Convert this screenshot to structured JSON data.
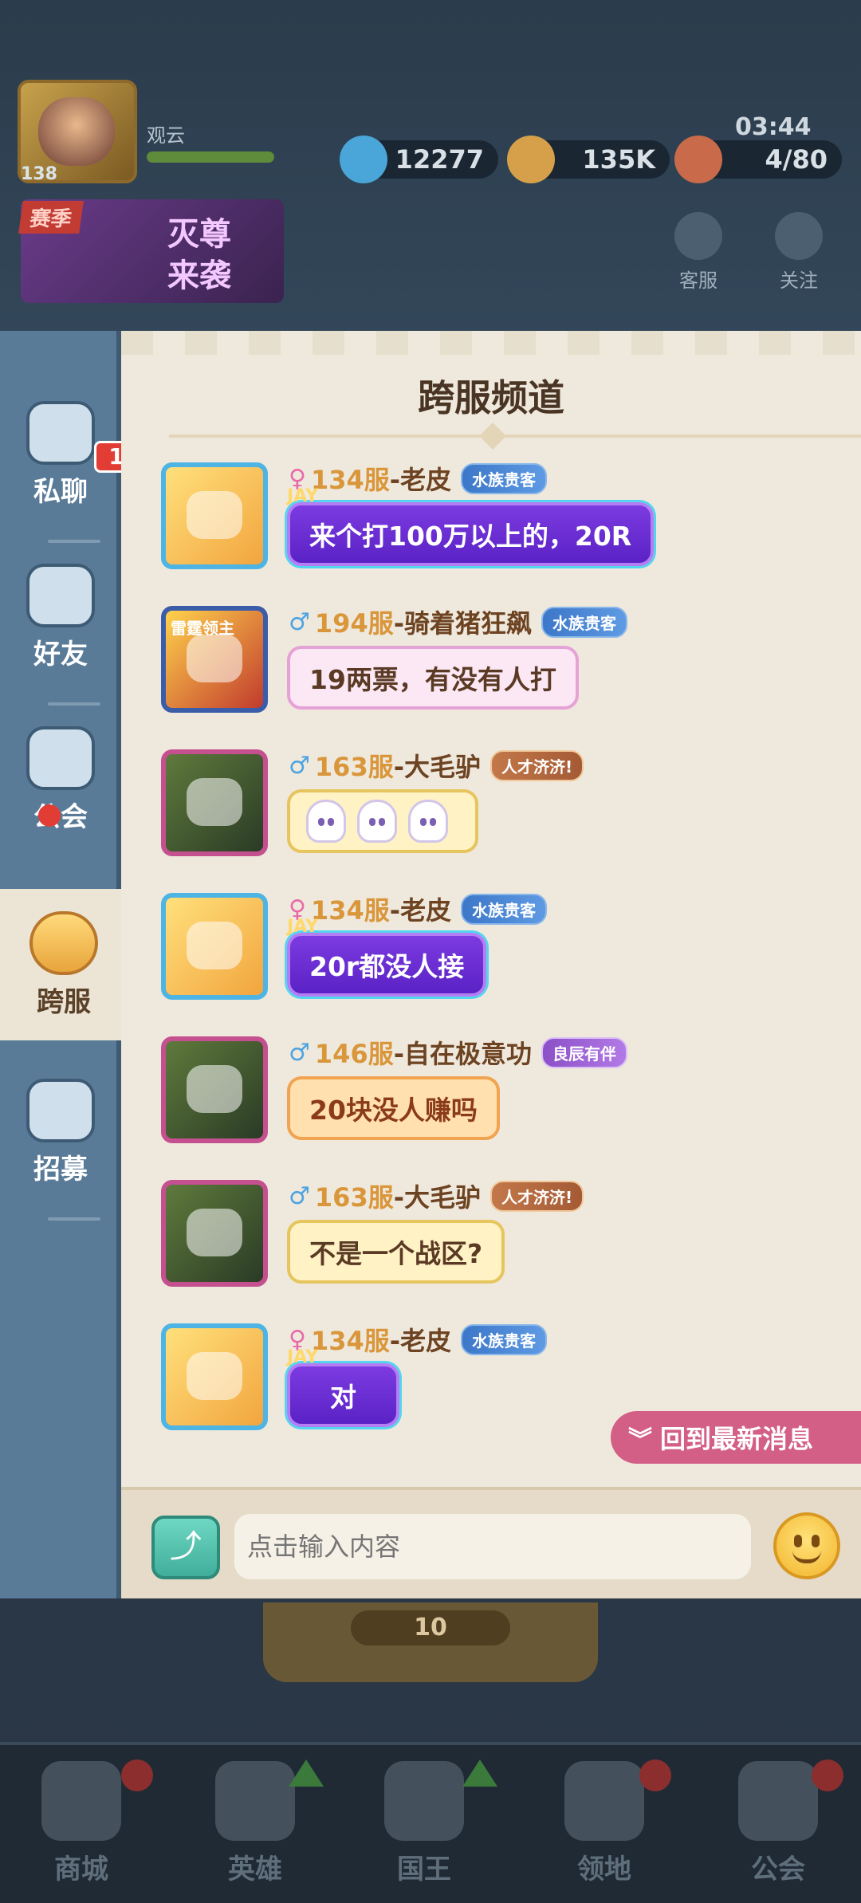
{
  "hud": {
    "player_name": "观云",
    "player_level": "138",
    "diamonds": "12277",
    "gold": "135K",
    "stamina": "4/80",
    "timer": "03:44",
    "season_tag": "赛季",
    "season_title": "灭尊\n来袭",
    "service_label": "客服",
    "follow_label": "关注"
  },
  "sidebar": {
    "items": [
      {
        "label": "私聊",
        "badge": "1"
      },
      {
        "label": "好友"
      },
      {
        "label": "公会"
      },
      {
        "label": "跨服"
      },
      {
        "label": "招募"
      }
    ]
  },
  "chat": {
    "title": "跨服频道",
    "messages": [
      {
        "gender": "♀",
        "server": "134服",
        "name": "-老皮",
        "tag": "水族贵客",
        "text": "来个打100万以上的，20R",
        "deco": "JAY"
      },
      {
        "gender": "♂",
        "server": "194服",
        "name": "-骑着猪狂飙",
        "tag": "水族贵客",
        "text": "19两票，有没有人打",
        "avatar_caption": "雷霆领主"
      },
      {
        "gender": "♂",
        "server": "163服",
        "name": "-大毛驴",
        "tag": "人才济济!",
        "text": ""
      },
      {
        "gender": "♀",
        "server": "134服",
        "name": "-老皮",
        "tag": "水族贵客",
        "text": "20r都没人接",
        "deco": "JAY"
      },
      {
        "gender": "♂",
        "server": "146服",
        "name": "-自在极意功",
        "tag": "良辰有伴",
        "text": "20块没人赚吗"
      },
      {
        "gender": "♂",
        "server": "163服",
        "name": "-大毛驴",
        "tag": "人才济济!",
        "text": "不是一个战区?"
      },
      {
        "gender": "♀",
        "server": "134服",
        "name": "-老皮",
        "tag": "水族贵客",
        "text": "对",
        "deco": "JAY"
      }
    ],
    "back_latest": "回到最新消息",
    "input_placeholder": "点击输入内容"
  },
  "bottom": {
    "stamina_cost": "10",
    "nav": [
      {
        "label": "商城"
      },
      {
        "label": "英雄"
      },
      {
        "label": "国王"
      },
      {
        "label": "领地"
      },
      {
        "label": "公会"
      }
    ]
  },
  "colors": {
    "panel_bg": "#efe9dd",
    "sidebar_bg": "#5a7b98",
    "server_text": "#d9963b",
    "name_text": "#6d4322",
    "back_latest_bg": "#d35f86"
  }
}
